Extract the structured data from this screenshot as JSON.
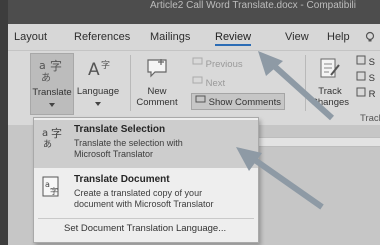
{
  "window": {
    "title": "Article2 Call Word Translate.docx - Compatibili"
  },
  "tabs": [
    "Layout",
    "References",
    "Mailings",
    "Review",
    "View",
    "Help"
  ],
  "active_tab": "Review",
  "ribbon": {
    "translate_label": "Translate",
    "language_label": "Language",
    "new_comment_line1": "New",
    "new_comment_line2": "Comment",
    "previous_label": "Previous",
    "next_label": "Next",
    "show_comments_label": "Show Comments",
    "track_changes_line1": "Track",
    "track_changes_line2": "Changes",
    "right_small_1": "S",
    "right_small_2": "S",
    "right_small_3": "R",
    "tracking_group_label": "Track"
  },
  "menu": {
    "items": [
      {
        "title": "Translate Selection",
        "desc_line1": "Translate the selection with",
        "desc_line2": "Microsoft Translator"
      },
      {
        "title": "Translate Document",
        "desc_line1": "Create a translated copy of your",
        "desc_line2": "document with Microsoft Translator"
      }
    ],
    "footer_link": "Set Document Translation Language..."
  },
  "colors": {
    "accent": "#2b6cb5",
    "arrow": "#8e9aa5"
  }
}
